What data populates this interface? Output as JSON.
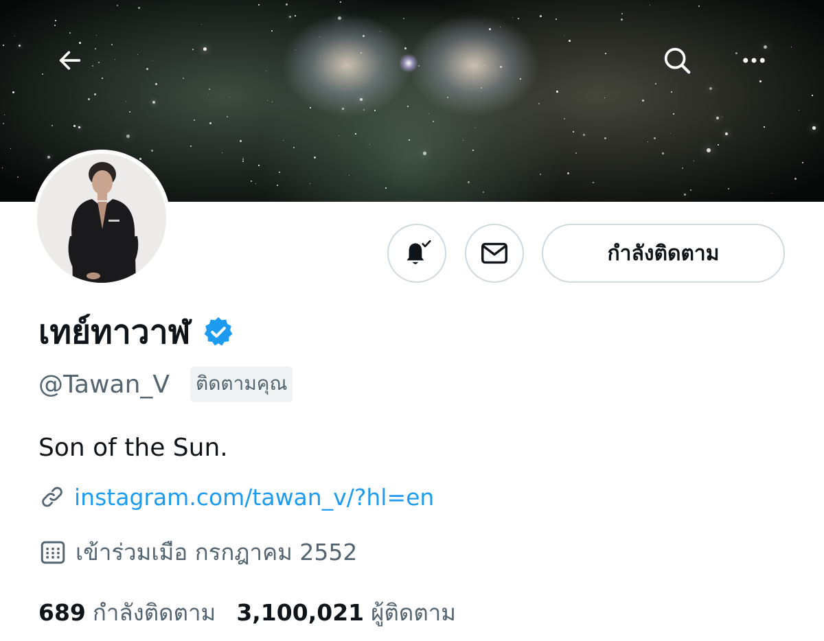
{
  "header": {
    "back_icon": "arrow-left-icon",
    "search_icon": "search-icon",
    "more_icon": "more-horizontal-icon"
  },
  "profile": {
    "display_name": "เทย์ทาวาฬ",
    "verified_icon": "verified-badge-icon",
    "handle": "@Tawan_V",
    "follows_you": "ติดตามคุณ",
    "bio": "Son of the Sun.",
    "link": "instagram.com/tawan_v/?hl=en",
    "joined": "เข้าร่วมเมือ กรกฎาคม 2552"
  },
  "actions": {
    "notifications_icon": "bell-subscribed-icon",
    "message_icon": "envelope-icon",
    "following_label": "กำลังติดตาม"
  },
  "stats": {
    "following_count": "689",
    "following_label": "กำลังติดตาม",
    "followers_count": "3,100,021",
    "followers_label": "ผู้ติดตาม"
  },
  "colors": {
    "accent": "#1d9bf0",
    "verified": "#1d9bf0",
    "secondary_text": "#536471",
    "border": "#cfd9de"
  }
}
